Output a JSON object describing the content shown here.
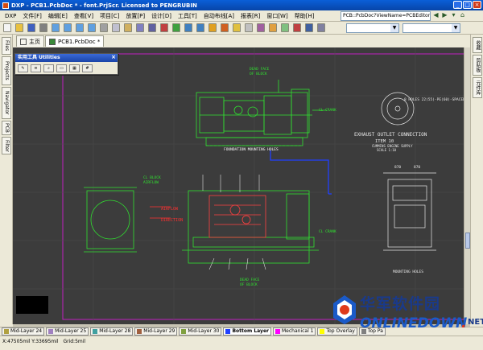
{
  "window": {
    "title": "DXP - PCB1.PcbDoc * - font.PrjScr. Licensed to PENGRUBIN"
  },
  "menubar": {
    "items": [
      "DXP",
      "文件[F]",
      "编辑[E]",
      "查看[V]",
      "项目[C]",
      "放置[P]",
      "设计[D]",
      "工具[T]",
      "自动布线[A]",
      "报表[R]",
      "窗口[W]",
      "帮助[H]"
    ]
  },
  "docpath": "PCB::PcbDoc?ViewName=PCBEditor",
  "tabs": [
    {
      "label": "主页"
    },
    {
      "label": "PCB1.PcbDoc *"
    }
  ],
  "left_panel": {
    "tabs": [
      "Files",
      "Projects",
      "Navigator",
      "PCB",
      "Filter"
    ]
  },
  "right_panel": {
    "tabs": [
      "收藏",
      "剪贴板",
      "元件库"
    ]
  },
  "utilities": {
    "title": "实用工具 Utilities"
  },
  "layers": [
    {
      "label": "Mid-Layer 24",
      "color": "#b0a040"
    },
    {
      "label": "Mid-Layer 25",
      "color": "#a080c0"
    },
    {
      "label": "Mid-Layer 28",
      "color": "#40a0a0"
    },
    {
      "label": "Mid-Layer 29",
      "color": "#a06040"
    },
    {
      "label": "Mid-Layer 30",
      "color": "#80a040"
    },
    {
      "label": "Bottom Layer",
      "color": "#2040ff",
      "active": true
    },
    {
      "label": "Mechanical 1",
      "color": "#ff00ff"
    },
    {
      "label": "Top Overlay",
      "color": "#ffff00"
    },
    {
      "label": "Top Pa",
      "color": "#808080"
    }
  ],
  "status": {
    "coords": "X:47505mil Y:33695mil",
    "grid": "Grid:5mil"
  },
  "drawing": {
    "labels": {
      "dead_face_top": "DEAD FACE\nOF BLOCK",
      "cl_crank_1": "CL CRANK",
      "foundation": "FOUNDATION MOUNTING HOLES",
      "exhaust_1": "EXHAUST OUTLET CONNECTION",
      "exhaust_2": "ITEM 10",
      "exhaust_3": "CUMMINS ENGINE SUPPLY",
      "exhaust_4": "SCALE 1:10",
      "holes": "8 HOLES 22(55)-PE(60)-SPACED",
      "cl_block": "CL BLOCK\nAIRFLOW",
      "airflow": "AIRFLOW",
      "direction": "DIRECTION",
      "cl_crank_2": "CL CRANK",
      "dead_face_bottom": "DEAD FACE\nOF BLOCK",
      "mounting": "MOUNTING HOLES",
      "dim_left": "870",
      "dim_right": "870"
    }
  },
  "watermark": {
    "cn": "华军软件园",
    "en": "ONLINEDOWN",
    "dot": ".",
    "suffix": "NET"
  }
}
